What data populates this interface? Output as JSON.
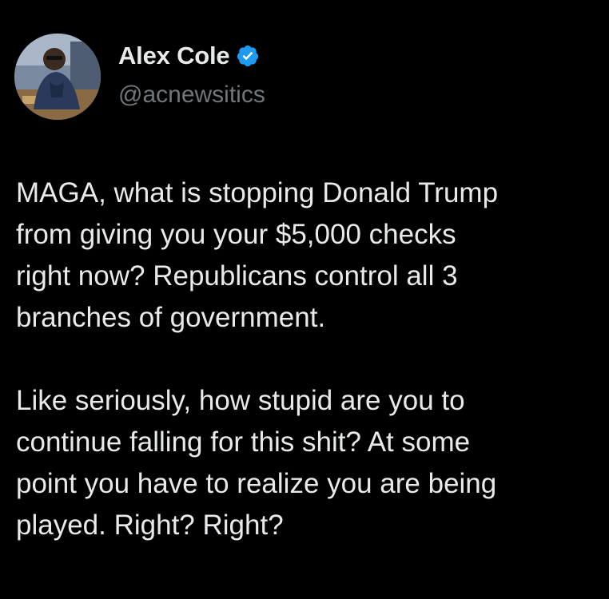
{
  "author": {
    "display_name": "Alex Cole",
    "handle": "@acnewsitics",
    "verified": true,
    "avatar_icon": "profile-photo",
    "verified_icon": "verified-badge-icon"
  },
  "tweet": {
    "paragraphs": [
      {
        "lines": [
          "MAGA, what is stopping Donald Trump",
          "from giving you your $5,000 checks",
          "right now? Republicans control all 3",
          "branches of government."
        ]
      },
      {
        "lines": [
          "Like seriously, how stupid are you to",
          "continue falling for this shit? At some",
          "point you have to realize you are being",
          "played. Right? Right?"
        ]
      }
    ]
  },
  "colors": {
    "background": "#000000",
    "text_primary": "#e7e9ea",
    "text_secondary": "#71767b",
    "verified_blue": "#1d9bf0"
  }
}
